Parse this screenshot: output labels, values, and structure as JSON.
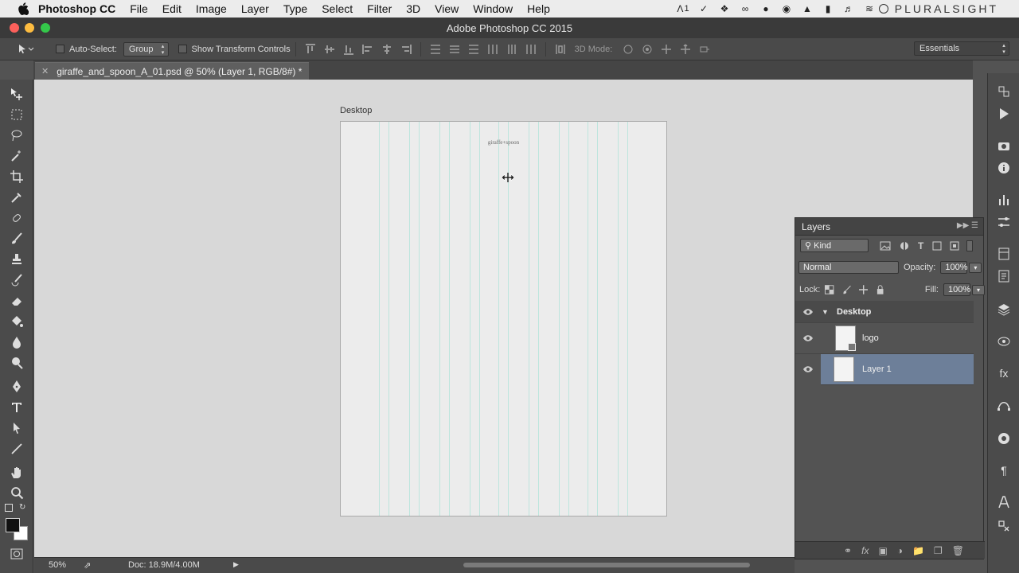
{
  "menubar": {
    "app_name": "Photoshop CC",
    "items": [
      "File",
      "Edit",
      "Image",
      "Layer",
      "Type",
      "Select",
      "Filter",
      "3D",
      "View",
      "Window",
      "Help"
    ],
    "status_icons": [
      "adobe-icon",
      "check-circle-icon",
      "dropbox-icon",
      "creative-cloud-icon",
      "evernote-icon",
      "github-icon",
      "drive-icon",
      "battery-icon",
      "volume-icon",
      "wifi-icon"
    ],
    "status_text": "1",
    "brand": "PLURALSIGHT"
  },
  "window": {
    "title": "Adobe Photoshop CC 2015"
  },
  "options": {
    "auto_select_label": "Auto-Select:",
    "auto_select_value": "Group",
    "transform_label": "Show Transform Controls",
    "mode_label": "3D Mode:",
    "workspace": "Essentials"
  },
  "document": {
    "tab_label": "giraffe_and_spoon_A_01.psd @ 50% (Layer 1, RGB/8#) *",
    "artboard_name": "Desktop",
    "logo_text": "giraffe+spoon"
  },
  "status": {
    "zoom": "50%",
    "doc_info": "Doc: 18.9M/4.00M"
  },
  "layers_panel": {
    "title": "Layers",
    "filter_kind": "Kind",
    "blend_mode": "Normal",
    "opacity_label": "Opacity:",
    "opacity_value": "100%",
    "lock_label": "Lock:",
    "fill_label": "Fill:",
    "fill_value": "100%",
    "group_name": "Desktop",
    "layers": [
      {
        "name": "logo",
        "selected": false
      },
      {
        "name": "Layer 1",
        "selected": true
      }
    ]
  },
  "colors": {
    "selected_layer": "#6d7f99",
    "guide": "#bde5dd",
    "canvas_bg": "#d8d8d8"
  }
}
